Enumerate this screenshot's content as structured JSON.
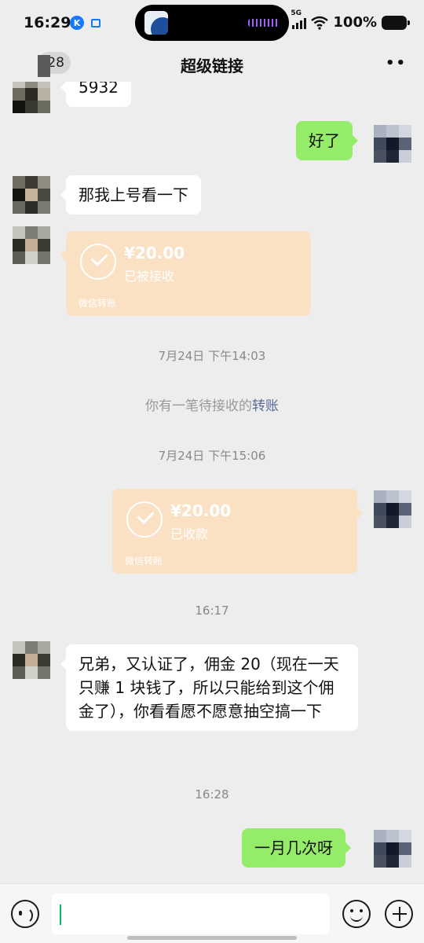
{
  "status_bar": {
    "time": "16:29",
    "k_badge": "K",
    "network": "5G",
    "battery": "100%"
  },
  "nav": {
    "unread_count": "28",
    "title": "超级链接",
    "more": "••"
  },
  "messages": {
    "partial_top_text": "5932",
    "me_ok": "好了",
    "them_login": "那我上号看一下",
    "transfer_in": {
      "amount": "¥20.00",
      "status": "已被接收",
      "footer": "微信转账"
    },
    "time1": "7月24日 下午14:03",
    "system_pending_prefix": "你有一笔待接收的",
    "system_pending_link": "转账",
    "time2": "7月24日 下午15:06",
    "transfer_out": {
      "amount": "¥20.00",
      "status": "已收款",
      "footer": "微信转账"
    },
    "time3": "16:17",
    "them_long": "兄弟，又认证了，佣金 20（现在一天只赚 1 块钱了，所以只能给到这个佣金了），你看看愿不愿意抽空搞一下",
    "time4": "16:28",
    "me_question": "一月几次呀"
  },
  "input": {
    "value": "",
    "placeholder": ""
  },
  "colors": {
    "self_bubble": "#95ec69",
    "transfer_bubble": "#fbe1c3",
    "link": "#576b95",
    "cursor": "#07c160"
  }
}
